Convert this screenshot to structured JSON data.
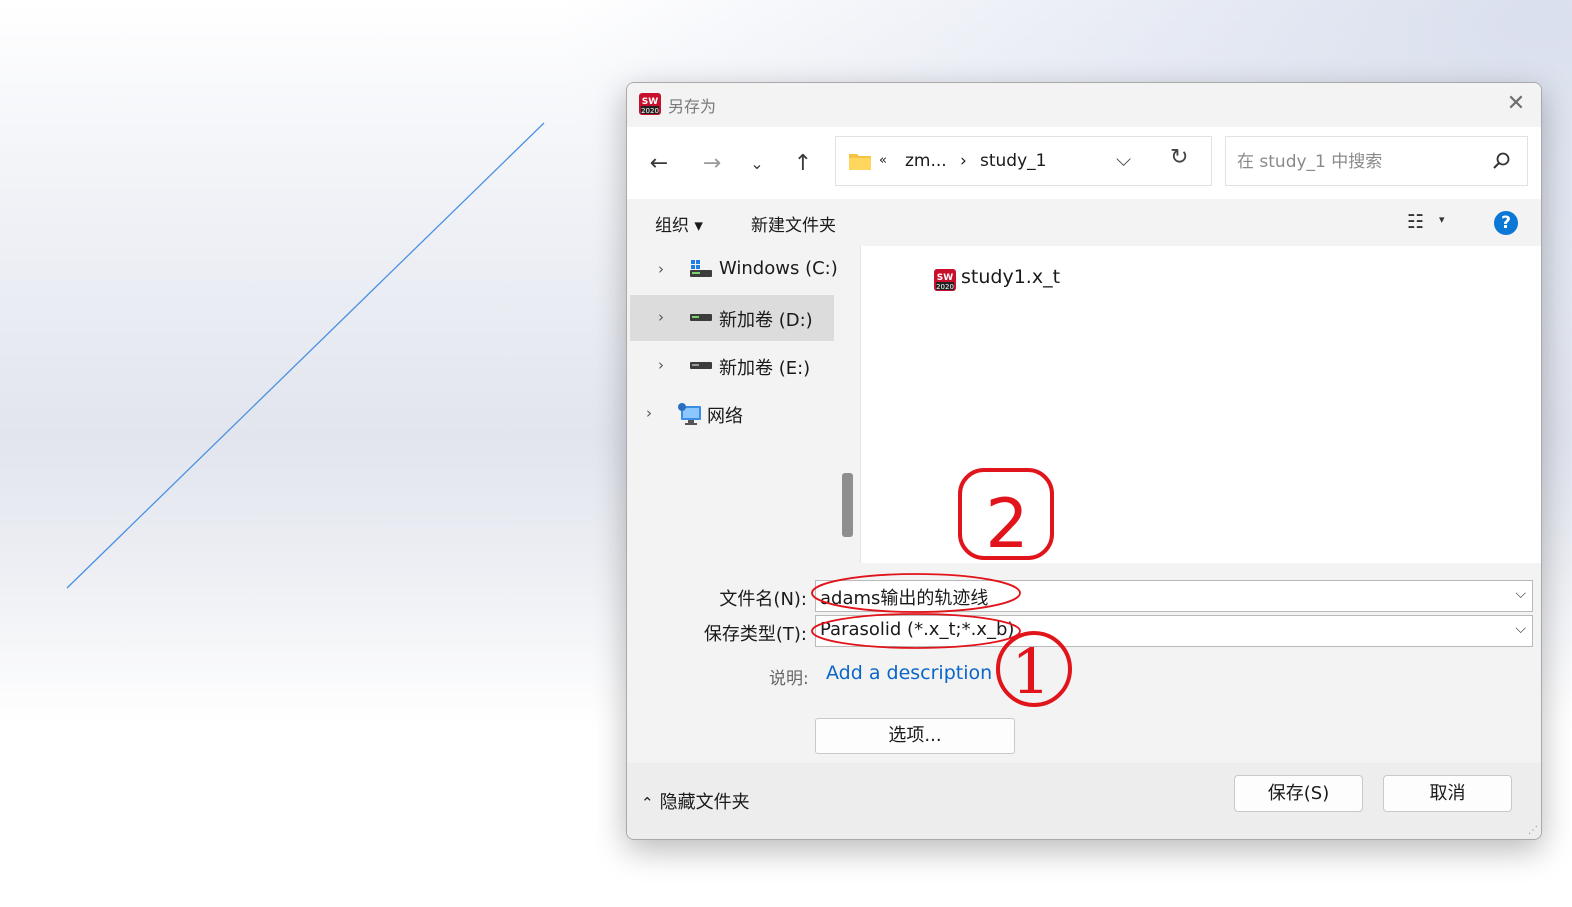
{
  "dialog": {
    "title": "另存为",
    "app_icon": "solidworks-2020-icon",
    "close_icon": "close-icon"
  },
  "nav": {
    "back_icon": "arrow-left-icon",
    "forward_icon": "arrow-right-icon",
    "recent_icon": "chevron-down-icon",
    "up_icon": "arrow-up-icon",
    "breadcrumb": {
      "overflow": "«",
      "parent": "zm...",
      "separator": "›",
      "current": "study_1"
    },
    "refresh_icon": "refresh-icon",
    "search_placeholder": "在 study_1 中搜索"
  },
  "toolbar": {
    "organize": "组织 ▾",
    "new_folder": "新建文件夹",
    "view_icon": "list-view-icon",
    "view_caret": "▾",
    "help": "?"
  },
  "sidebar": {
    "items": [
      {
        "label": "Windows (C:)",
        "icon": "windows-drive-icon",
        "selected": false
      },
      {
        "label": "新加卷 (D:)",
        "icon": "drive-icon",
        "selected": true
      },
      {
        "label": "新加卷 (E:)",
        "icon": "drive-icon",
        "selected": false
      },
      {
        "label": "网络",
        "icon": "network-icon",
        "selected": false
      }
    ]
  },
  "files": [
    {
      "name": "study1.x_t",
      "icon": "solidworks-file-icon"
    }
  ],
  "form": {
    "filename_label": "文件名(N):",
    "filename_value": "adams输出的轨迹线",
    "filetype_label": "保存类型(T):",
    "filetype_value": "Parasolid (*.x_t;*.x_b)",
    "description_label": "说明:",
    "description_link": "Add a description",
    "options_button": "选项..."
  },
  "footer": {
    "hide_folders": "隐藏文件夹",
    "save_button": "保存(S)",
    "cancel_button": "取消"
  },
  "annotations": {
    "marker_1": "1",
    "marker_2": "2",
    "color": "#e0141a"
  },
  "colors": {
    "accent": "#0a78d4",
    "link": "#0a66c8",
    "sketch_line": "#4a90e2"
  }
}
